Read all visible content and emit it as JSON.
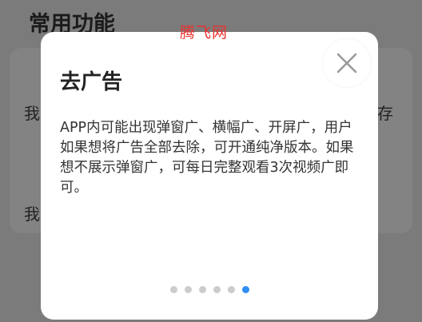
{
  "background": {
    "section_title": "常用功能",
    "left_char_1": "我",
    "left_char_2": "我",
    "right_char_1": "存"
  },
  "watermark": "腾飞网",
  "dialog": {
    "title": "去广告",
    "body": "APP内可能出现弹窗广、横幅广、开屏广，用户如果想将广告全部去除，可开通纯净版本。如果想不展示弹窗广，可每日完整观看3次视频广即可。",
    "close_icon": "close-icon",
    "pages": {
      "total": 6,
      "active_index": 6
    },
    "colors": {
      "active_dot": "#2f8ef5",
      "inactive_dot": "#cccccc"
    }
  }
}
